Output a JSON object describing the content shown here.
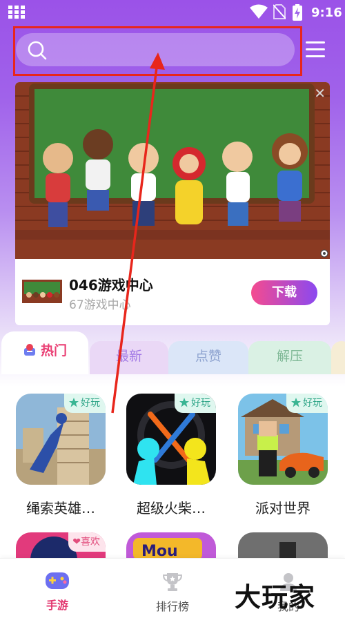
{
  "status_bar": {
    "time": "9:16"
  },
  "search": {
    "placeholder": ""
  },
  "ad": {
    "title": "046游戏中心",
    "subtitle": "67游戏中心",
    "download_label": "下载"
  },
  "tabs": [
    {
      "label": "热门",
      "active": true
    },
    {
      "label": "最新",
      "active": false
    },
    {
      "label": "点赞",
      "active": false
    },
    {
      "label": "解压",
      "active": false
    }
  ],
  "games": [
    {
      "name": "绳索英雄…",
      "badge": "好玩"
    },
    {
      "name": "超级火柴…",
      "badge": "好玩"
    },
    {
      "name": "派对世界",
      "badge": "好玩"
    },
    {
      "name": "",
      "badge": "喜欢"
    },
    {
      "name": "",
      "badge": ""
    },
    {
      "name": "",
      "badge": ""
    }
  ],
  "game_tile_text": {
    "mou_logo": "Mou"
  },
  "bottom_nav": [
    {
      "label": "手游",
      "active": true
    },
    {
      "label": "排行榜",
      "active": false
    },
    {
      "label": "我的",
      "active": false
    }
  ],
  "watermark": "大玩家",
  "colors": {
    "header_purple": "#9b52e8",
    "accent_pink": "#ea3f74",
    "download_gradient_start": "#f44b8f",
    "download_gradient_end": "#8b49f0",
    "highlight_red": "#e8261c",
    "badge_green": "#2da486"
  }
}
